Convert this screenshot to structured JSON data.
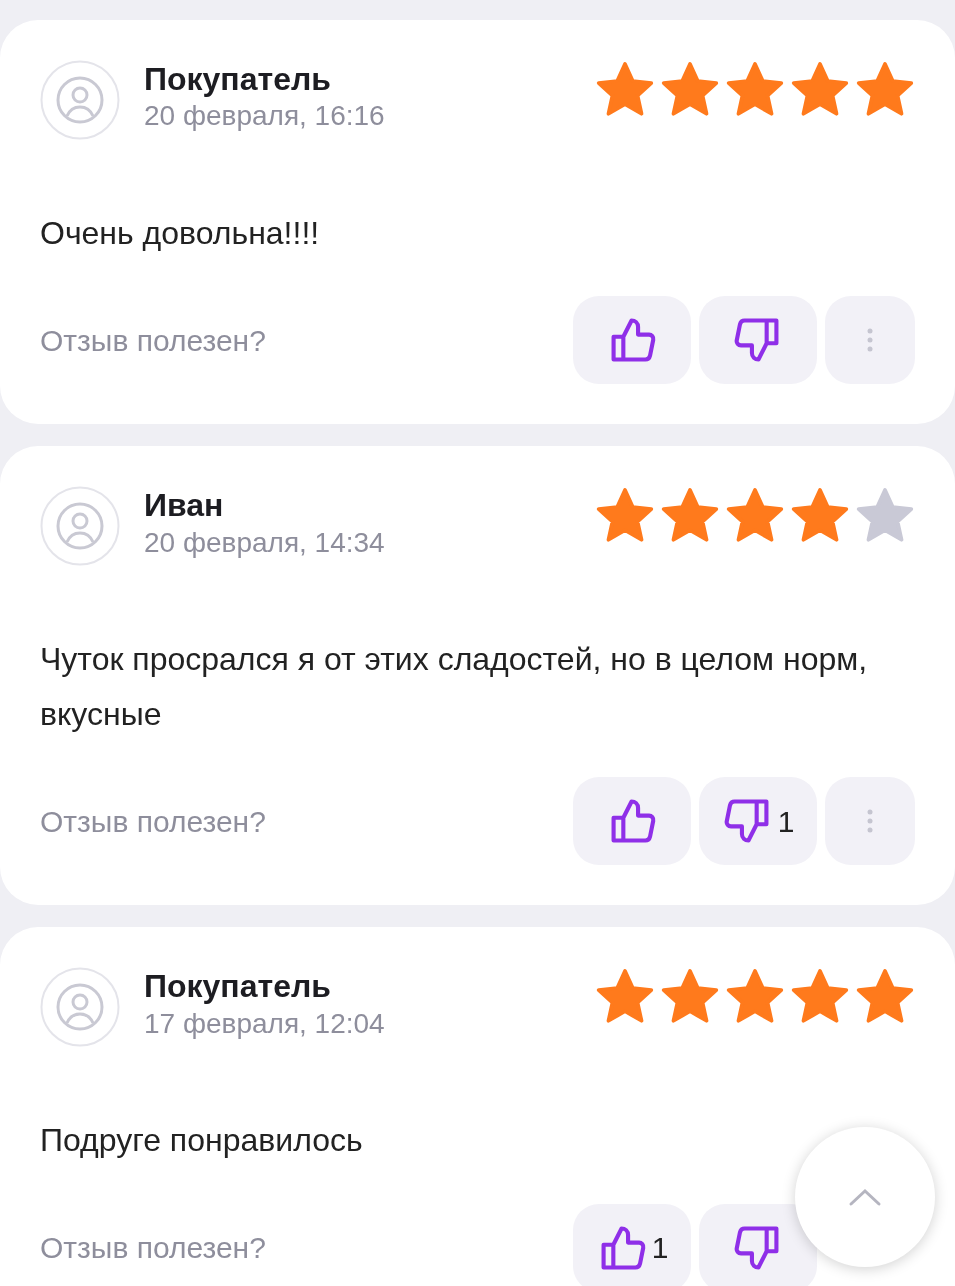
{
  "reviews": [
    {
      "author": "Покупатель",
      "date": "20 февраля, 16:16",
      "stars": 5,
      "text": "Очень довольна!!!!",
      "helpful_label": "Отзыв полезен?",
      "more_button": true
    },
    {
      "author": "Иван",
      "date": "20 февраля, 14:34",
      "stars": 4,
      "text": "Чуток просрался я от этих сладостей, но в целом норм, вкусные",
      "helpful_label": "Отзыв полезен?",
      "dislikes": {
        "count": "1"
      },
      "more_button": true
    },
    {
      "author": "Покупатель",
      "date": "17 февраля, 12:04",
      "stars": 5,
      "text": "Подруге понравилось",
      "helpful_label": "Отзыв полезен?",
      "likes": {
        "count": "1"
      }
    }
  ]
}
